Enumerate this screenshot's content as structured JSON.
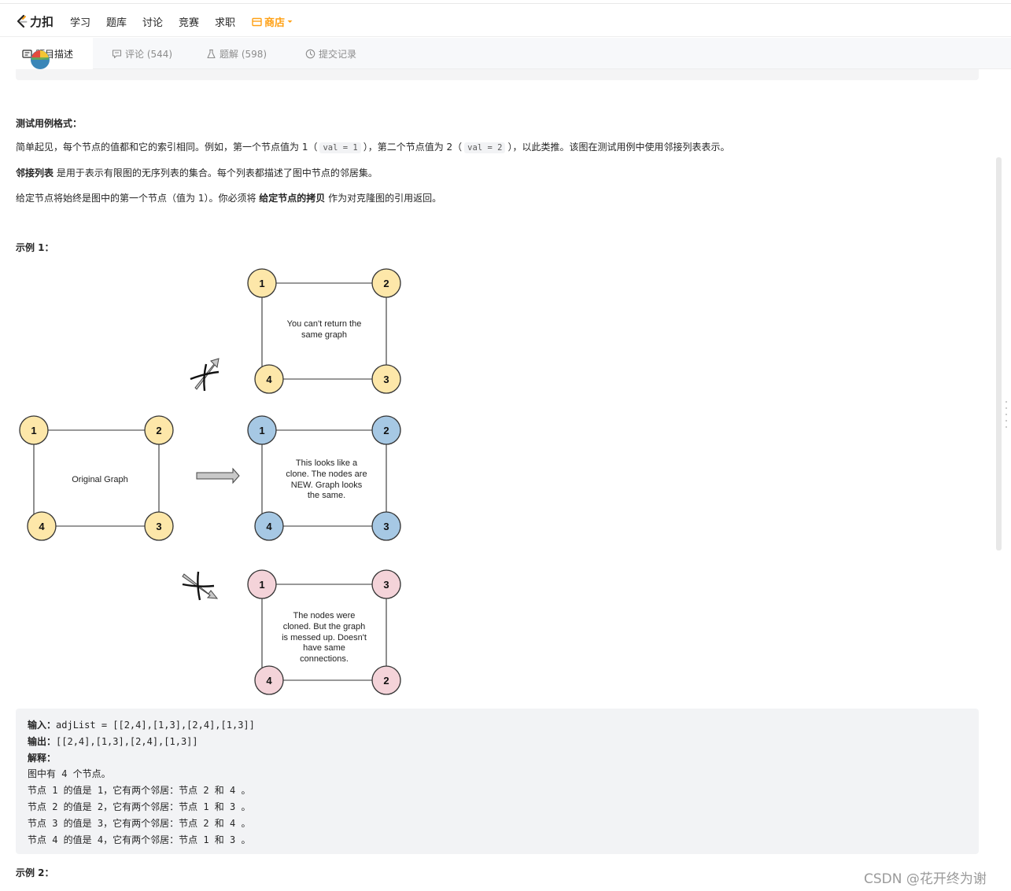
{
  "brand": {
    "name": "力扣"
  },
  "nav": {
    "items": [
      "学习",
      "题库",
      "讨论",
      "竞赛",
      "求职"
    ],
    "store": "商店"
  },
  "tabs": [
    {
      "label": "题目描述",
      "active": true
    },
    {
      "label": "评论 (544)"
    },
    {
      "label": "题解 (598)"
    },
    {
      "label": "提交记录"
    }
  ],
  "desc": {
    "test_format_title": "测试用例格式：",
    "p1_a": "简单起见，每个节点的值都和它的索引相同。例如，第一个节点值为 1（",
    "p1_code1": "val = 1",
    "p1_b": "），第二个节点值为 2（",
    "p1_code2": "val = 2",
    "p1_c": "），以此类推。该图在测试用例中使用邻接列表表示。",
    "p2_bold": "邻接列表",
    "p2_rest": " 是用于表示有限图的无序列表的集合。每个列表都描述了图中节点的邻居集。",
    "p3_a": "给定节点将始终是图中的第一个节点（值为 1）。你必须将 ",
    "p3_bold": "给定节点的拷贝",
    "p3_b": " 作为对克隆图的引用返回。",
    "example1_title": "示例 1：",
    "example2_title": "示例 2："
  },
  "figure": {
    "original": {
      "label": "Original Graph",
      "nodes": [
        "1",
        "2",
        "4",
        "3"
      ],
      "color": "#fde7a9"
    },
    "same": {
      "label_lines": [
        "You can't return the",
        "same graph"
      ],
      "nodes": [
        "1",
        "2",
        "4",
        "3"
      ],
      "color": "#fde7a9"
    },
    "clone": {
      "label_lines": [
        "This looks like a",
        "clone. The nodes are",
        "NEW. Graph looks",
        "the same."
      ],
      "nodes": [
        "1",
        "2",
        "4",
        "3"
      ],
      "color": "#a6c8e4"
    },
    "messed": {
      "label_lines": [
        "The nodes were",
        "cloned. But the graph",
        "is messed up. Doesn't",
        "have same",
        "connections."
      ],
      "nodes": [
        "1",
        "3",
        "4",
        "2"
      ],
      "color": "#f4d3d9"
    }
  },
  "example1": {
    "input_label": "输入：",
    "input_value": "adjList = [[2,4],[1,3],[2,4],[1,3]]",
    "output_label": "输出：",
    "output_value": "[[2,4],[1,3],[2,4],[1,3]]",
    "explain_label": "解释：",
    "lines": [
      "图中有 4 个节点。",
      "节点 1 的值是 1，它有两个邻居：节点 2 和 4 。",
      "节点 2 的值是 2，它有两个邻居：节点 1 和 3 。",
      "节点 3 的值是 3，它有两个邻居：节点 2 和 4 。",
      "节点 4 的值是 4，它有两个邻居：节点 1 和 3 。"
    ]
  },
  "watermark": "CSDN @花开终为谢"
}
